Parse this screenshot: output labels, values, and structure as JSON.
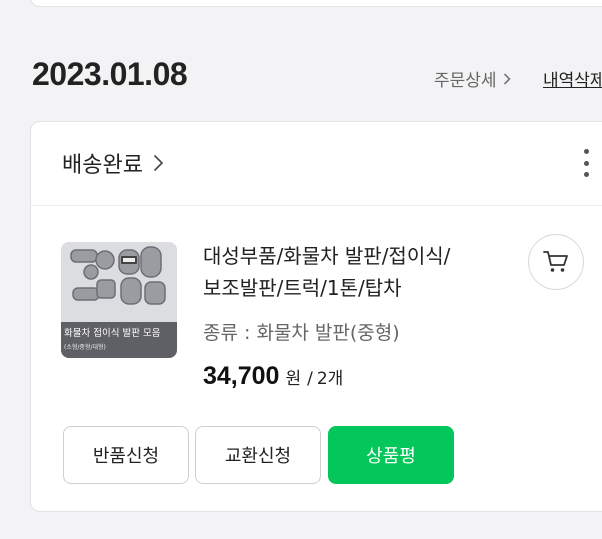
{
  "order": {
    "date": "2023.01.08",
    "detail_label": "주문상세",
    "history_label": "내역삭제"
  },
  "card": {
    "status_label": "배송완료"
  },
  "product": {
    "thumbnail_caption": "화물차 접이식 발판 모음",
    "thumbnail_subcaption": "(소형/중형/대형)",
    "name": "대성부품/화물차 발판/접이식/보조발판/트럭/1톤/탑차",
    "option": "종류 : 화물차 발판(중형)",
    "price": "34,700",
    "currency": "원",
    "separator": "/",
    "quantity": "2개"
  },
  "actions": {
    "return_label": "반품신청",
    "exchange_label": "교환신청",
    "review_label": "상품평"
  },
  "colors": {
    "accent_green": "#03c75a",
    "background": "#f3f3f5"
  },
  "icons": [
    "chevron-right-icon",
    "more-vertical-icon",
    "cart-icon"
  ]
}
